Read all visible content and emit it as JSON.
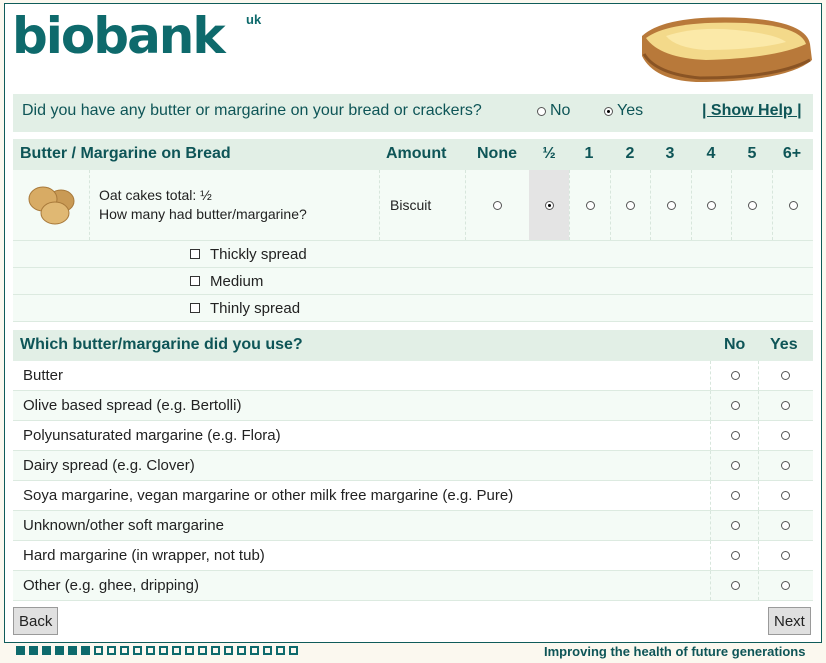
{
  "header": {
    "logo_text": "biobank",
    "logo_suffix": "uk"
  },
  "question": {
    "text": "Did you have any butter or margarine on your bread or crackers?",
    "options": [
      {
        "label": "No",
        "selected": false
      },
      {
        "label": "Yes",
        "selected": true
      }
    ],
    "help_label": "| Show Help |"
  },
  "table1": {
    "headers": {
      "item": "Butter / Margarine on Bread",
      "amount": "Amount"
    },
    "columns": [
      "None",
      "½",
      "1",
      "2",
      "3",
      "4",
      "5",
      "6+"
    ],
    "row": {
      "line1": "Oat cakes total: ½",
      "line2": "How many had butter/margarine?",
      "amount": "Biscuit",
      "selected": "½"
    },
    "spread_options": [
      "Thickly spread",
      "Medium",
      "Thinly spread"
    ]
  },
  "table2": {
    "header": "Which butter/margarine did you use?",
    "col_no": "No",
    "col_yes": "Yes",
    "rows": [
      "Butter",
      "Olive based spread (e.g. Bertolli)",
      "Polyunsaturated margarine (e.g. Flora)",
      "Dairy spread (e.g. Clover)",
      "Soya margarine, vegan margarine or other milk free margarine (e.g. Pure)",
      "Unknown/other soft margarine",
      "Hard margarine (in wrapper, not tub)",
      "Other (e.g. ghee, dripping)"
    ]
  },
  "nav": {
    "back_label": "Back",
    "next_label": "Next"
  },
  "progress": {
    "completed": 6,
    "total": 22
  },
  "footer": {
    "tagline": "Improving the health of future generations"
  },
  "colors": {
    "accent": "#0e6a6c",
    "header_bg": "#e2efe6",
    "row_bg": "#f4fbf6"
  }
}
